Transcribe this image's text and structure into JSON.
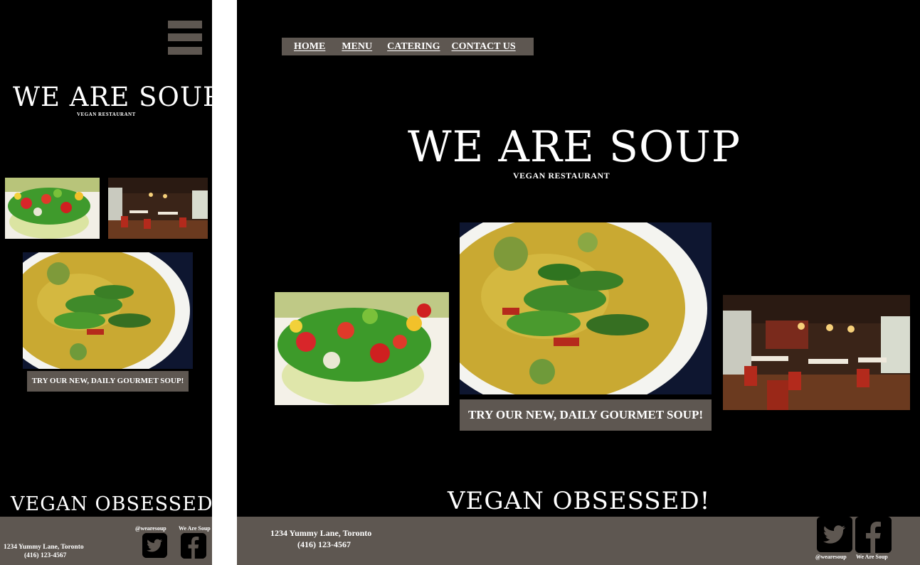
{
  "brand": {
    "name": "WE ARE SOUP",
    "tagline": "VEGAN RESTAURANT"
  },
  "nav": {
    "items": [
      {
        "label": "HOME"
      },
      {
        "label": "MENU"
      },
      {
        "label": "CATERING"
      },
      {
        "label": "CONTACT US"
      }
    ]
  },
  "promo": {
    "label": "TRY OUR NEW, DAILY GOURMET SOUP!"
  },
  "slogan": "VEGAN OBSESSED!",
  "footer": {
    "address": "1234 Yummy Lane, Toronto",
    "phone": "(416) 123-4567",
    "twitter_handle": "@wearesoup",
    "facebook_name": "We Are Soup"
  },
  "colors": {
    "background": "#000000",
    "accent": "#5e5751",
    "text": "#ffffff"
  },
  "icons": {
    "menu": "hamburger-icon",
    "twitter": "twitter-bird-icon",
    "facebook": "facebook-f-icon"
  }
}
